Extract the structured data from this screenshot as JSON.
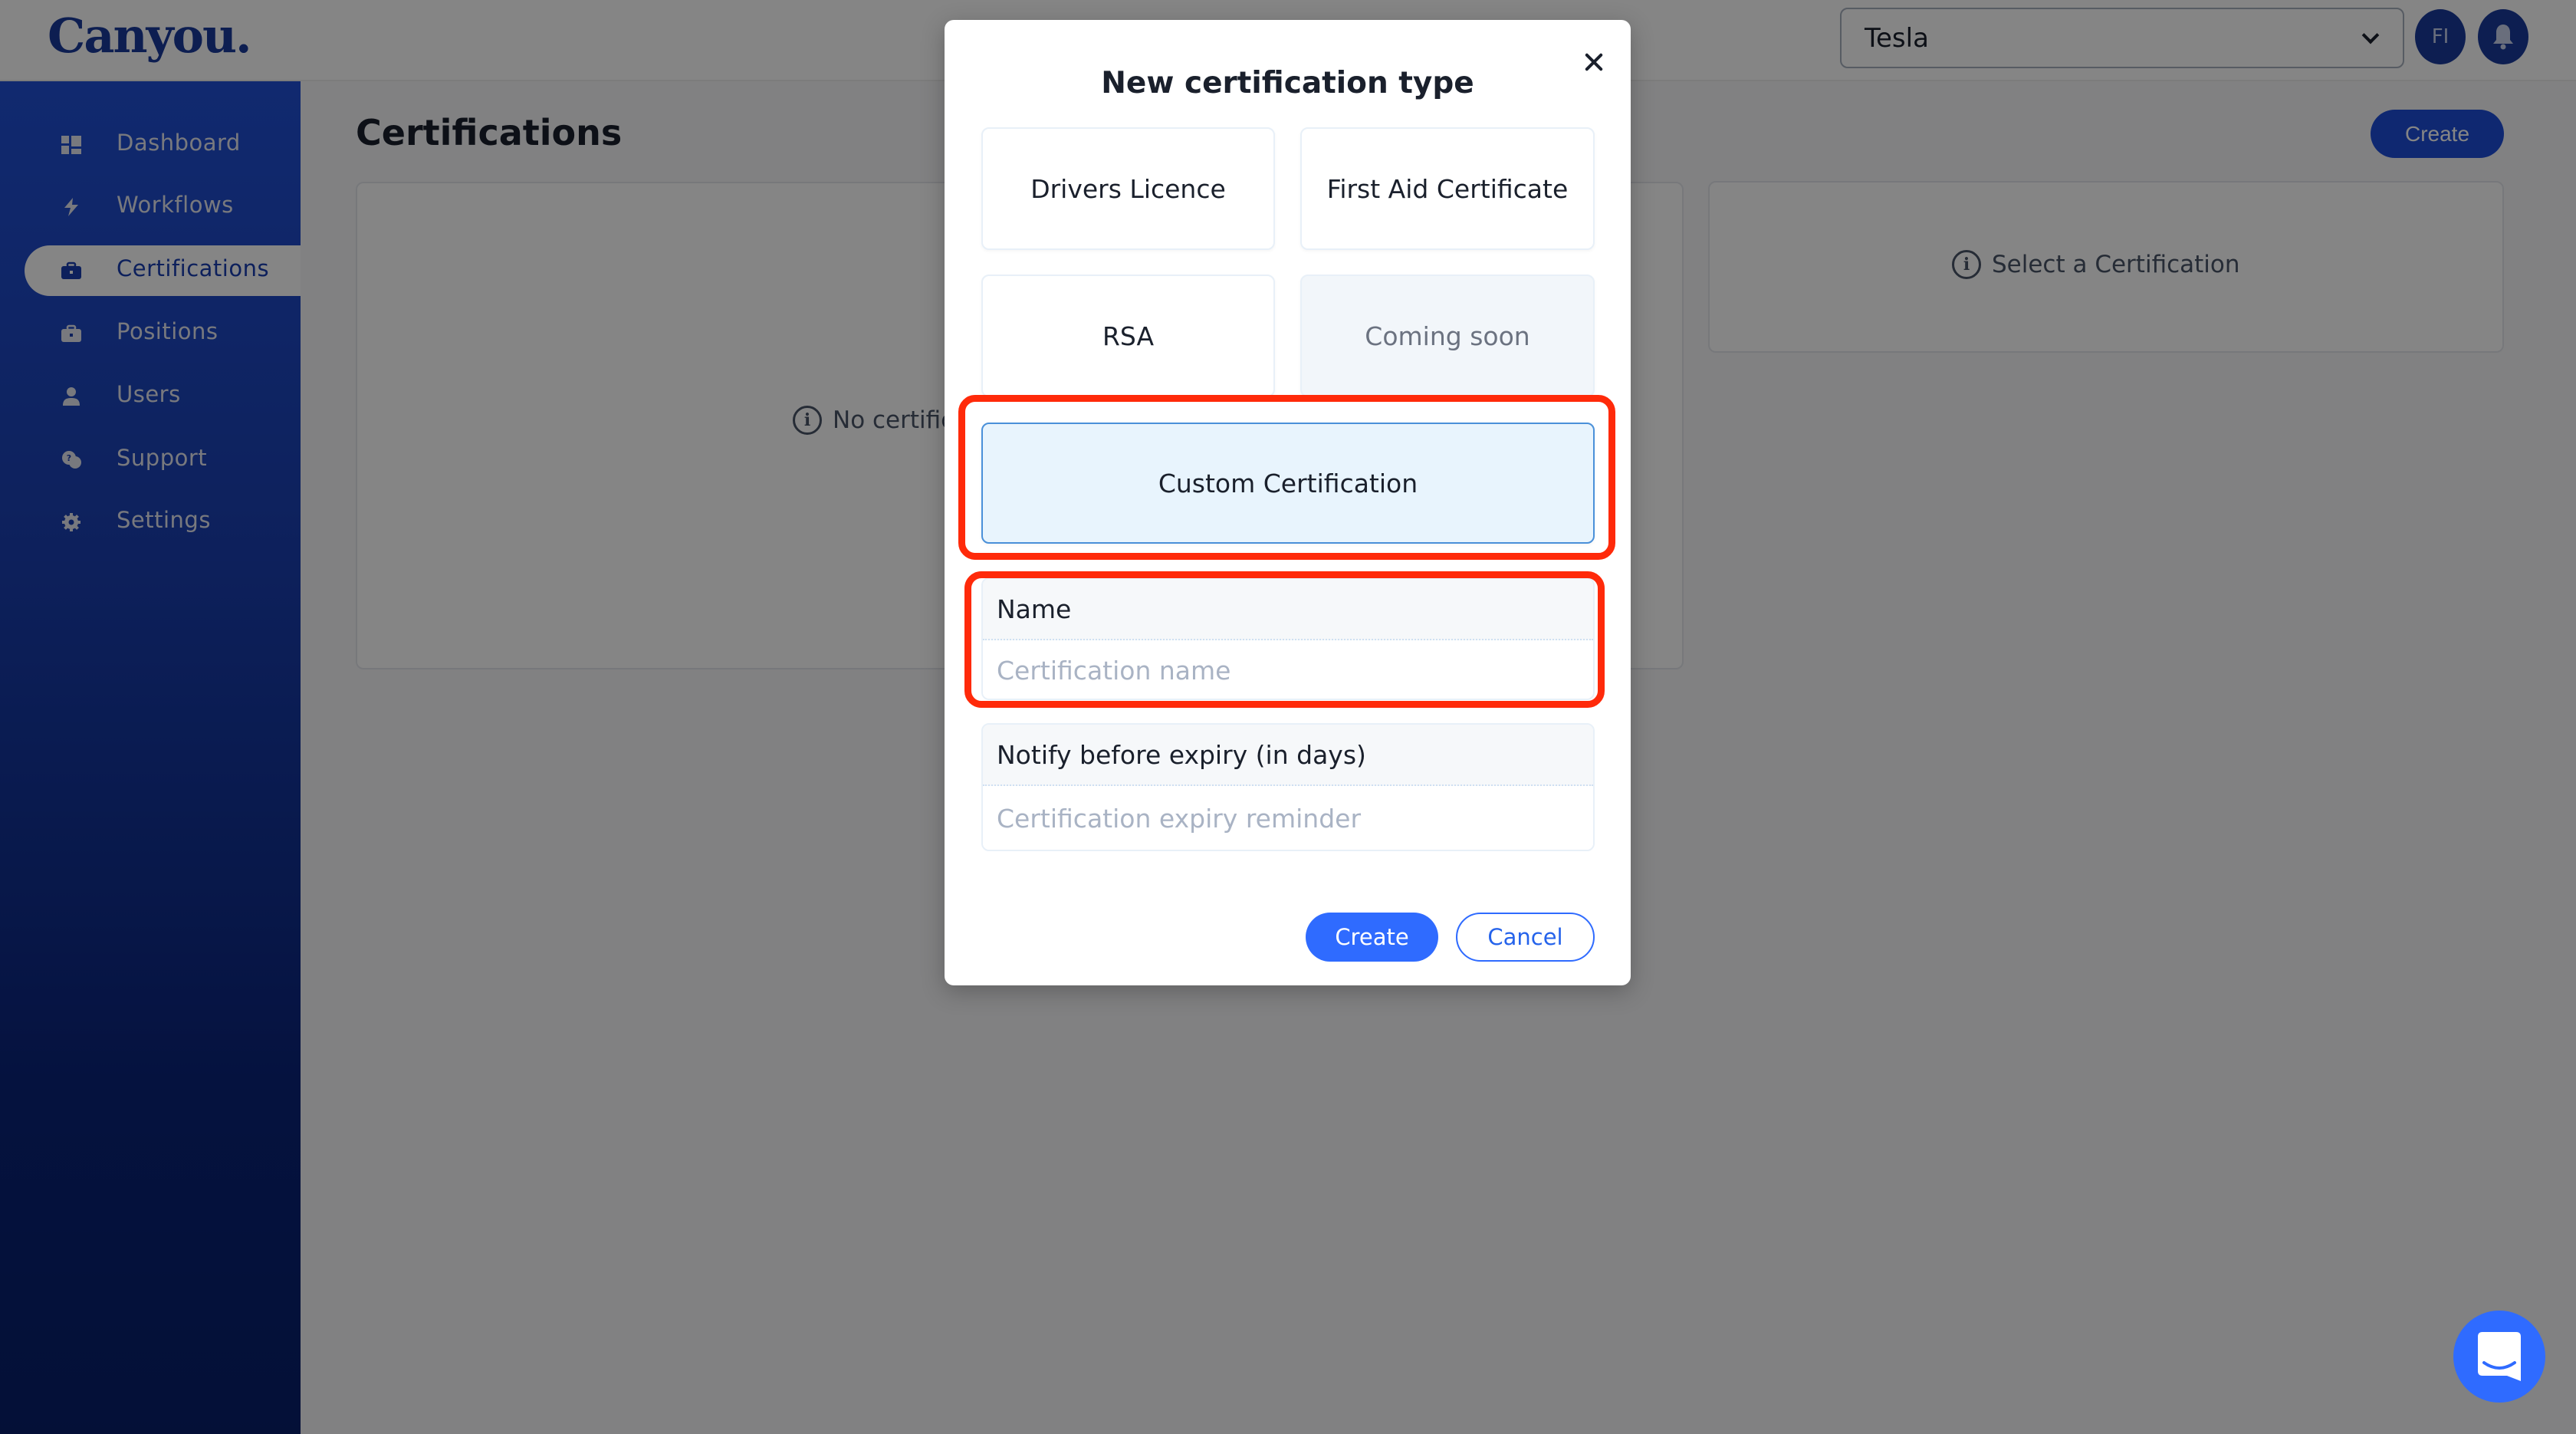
{
  "app": {
    "logo": "Canyou."
  },
  "header": {
    "organization_select": {
      "value": "Tesla"
    },
    "avatar_initials": "FI",
    "icons": {
      "notifications": "bell-icon",
      "dropdown": "chevron-down-icon"
    }
  },
  "sidebar": {
    "items": [
      {
        "label": "Dashboard",
        "icon": "dashboard-icon",
        "active": false
      },
      {
        "label": "Workflows",
        "icon": "lightning-icon",
        "active": false
      },
      {
        "label": "Certifications",
        "icon": "briefcase-icon",
        "active": true
      },
      {
        "label": "Positions",
        "icon": "briefcase-icon",
        "active": false
      },
      {
        "label": "Users",
        "icon": "user-icon",
        "active": false
      },
      {
        "label": "Support",
        "icon": "support-chat-icon",
        "active": false
      },
      {
        "label": "Settings",
        "icon": "gear-icon",
        "active": false
      }
    ]
  },
  "main": {
    "title": "Certifications",
    "create_label": "Create",
    "list_empty_message": "No certifications",
    "detail_empty_message": "Select a Certification"
  },
  "modal": {
    "title": "New certification type",
    "options": [
      {
        "label": "Drivers Licence",
        "state": "default"
      },
      {
        "label": "First Aid Certificate",
        "state": "default"
      },
      {
        "label": "RSA",
        "state": "default"
      },
      {
        "label": "Coming soon",
        "state": "disabled"
      },
      {
        "label": "Custom Certification",
        "state": "selected"
      }
    ],
    "fields": {
      "name": {
        "label": "Name",
        "placeholder": "Certification name",
        "value": ""
      },
      "notify": {
        "label": "Notify before expiry (in days)",
        "placeholder": "Certification expiry reminder",
        "value": ""
      }
    },
    "create_label": "Create",
    "cancel_label": "Cancel"
  },
  "colors": {
    "brand": "#1a3a9c",
    "primary_button": "#2f6bff",
    "annotation": "#ff2a0a",
    "selected_option_bg": "#e8f4fd"
  }
}
